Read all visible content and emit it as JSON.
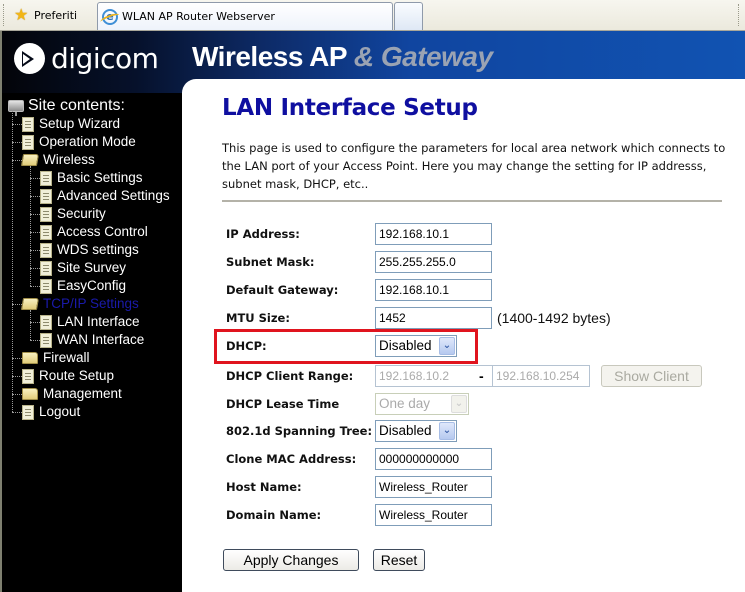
{
  "browser": {
    "favorites_label": "Preferiti",
    "tab_title": "WLAN AP Router Webserver"
  },
  "header": {
    "logo_text": "digicom",
    "brand_main": "Wireless AP",
    "brand_sub": "& Gateway"
  },
  "sidebar": {
    "root_label": "Site contents:",
    "items": [
      {
        "label": "Setup Wizard",
        "type": "doc",
        "level": 1
      },
      {
        "label": "Operation Mode",
        "type": "doc",
        "level": 1
      },
      {
        "label": "Wireless",
        "type": "folder-open",
        "level": 1
      },
      {
        "label": "Basic Settings",
        "type": "doc",
        "level": 2
      },
      {
        "label": "Advanced Settings",
        "type": "doc",
        "level": 2
      },
      {
        "label": "Security",
        "type": "doc",
        "level": 2
      },
      {
        "label": "Access Control",
        "type": "doc",
        "level": 2
      },
      {
        "label": "WDS settings",
        "type": "doc",
        "level": 2
      },
      {
        "label": "Site Survey",
        "type": "doc",
        "level": 2
      },
      {
        "label": "EasyConfig",
        "type": "doc",
        "level": 2
      },
      {
        "label": "TCP/IP Settings",
        "type": "folder-open",
        "level": 1,
        "active": true
      },
      {
        "label": "LAN Interface",
        "type": "doc",
        "level": 2
      },
      {
        "label": "WAN Interface",
        "type": "doc",
        "level": 2
      },
      {
        "label": "Firewall",
        "type": "folder",
        "level": 1
      },
      {
        "label": "Route Setup",
        "type": "doc",
        "level": 1
      },
      {
        "label": "Management",
        "type": "folder",
        "level": 1
      },
      {
        "label": "Logout",
        "type": "doc",
        "level": 1
      }
    ]
  },
  "main": {
    "title": "LAN Interface Setup",
    "description": "This page is used to configure the parameters for local area network which connects to the LAN port of your Access Point. Here you may change the setting for IP addresss, subnet mask, DHCP, etc..",
    "fields": {
      "ip_address": {
        "label": "IP Address:",
        "value": "192.168.10.1"
      },
      "subnet_mask": {
        "label": "Subnet Mask:",
        "value": "255.255.255.0"
      },
      "default_gateway": {
        "label": "Default Gateway:",
        "value": "192.168.10.1"
      },
      "mtu_size": {
        "label": "MTU Size:",
        "value": "1452",
        "note": "(1400-1492 bytes)"
      },
      "dhcp": {
        "label": "DHCP:",
        "selected": "Disabled"
      },
      "dhcp_client_range": {
        "label": "DHCP Client Range:",
        "start": "192.168.10.2",
        "separator": "-",
        "end": "192.168.10.254",
        "show_client_label": "Show Client"
      },
      "dhcp_lease_time": {
        "label": "DHCP Lease Time",
        "selected": "One day"
      },
      "spanning_tree": {
        "label": "802.1d Spanning Tree:",
        "selected": "Disabled"
      },
      "clone_mac": {
        "label": "Clone MAC Address:",
        "value": "000000000000"
      },
      "host_name": {
        "label": "Host Name:",
        "value": "Wireless_Router"
      },
      "domain_name": {
        "label": "Domain Name:",
        "value": "Wireless_Router"
      }
    },
    "buttons": {
      "apply": "Apply Changes",
      "reset": "Reset"
    },
    "highlight_color": "#e0141e"
  }
}
